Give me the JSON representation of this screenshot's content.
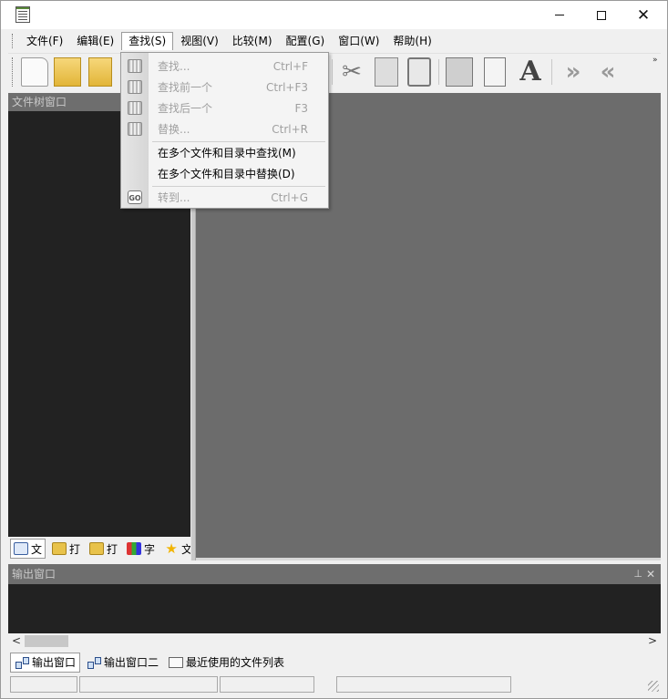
{
  "window": {
    "app_icon": "document-icon",
    "controls": {
      "minimize": "minimize-icon",
      "maximize": "maximize-icon",
      "close": "✕"
    }
  },
  "menubar": {
    "items": [
      "文件(F)",
      "编辑(E)",
      "查找(S)",
      "视图(V)",
      "比较(M)",
      "配置(G)",
      "窗口(W)",
      "帮助(H)"
    ],
    "active_index": 2
  },
  "toolbar": {
    "overflow": "»",
    "icons": [
      "new-document-icon",
      "open-folder-icon",
      "open-project-icon",
      "cut-icon",
      "copy-icon",
      "paste-icon",
      "select-icon",
      "list-icon",
      "font-icon",
      "next-difference-icon",
      "previous-difference-icon"
    ],
    "font_glyph": "A",
    "scissors_glyph": "✂",
    "next_glyph": "»",
    "prev_glyph": "«"
  },
  "search_menu": {
    "items": [
      {
        "label": "查找...",
        "shortcut": "Ctrl+F",
        "enabled": false,
        "icon": "binoculars-icon"
      },
      {
        "label": "查找前一个",
        "shortcut": "Ctrl+F3",
        "enabled": false,
        "icon": "find-previous-icon"
      },
      {
        "label": "查找后一个",
        "shortcut": "F3",
        "enabled": false,
        "icon": "find-next-icon"
      },
      {
        "label": "替换...",
        "shortcut": "Ctrl+R",
        "enabled": false,
        "icon": "replace-icon"
      },
      {
        "label": "在多个文件和目录中查找(M)",
        "shortcut": "",
        "enabled": true,
        "icon": ""
      },
      {
        "label": "在多个文件和目录中替换(D)",
        "shortcut": "",
        "enabled": true,
        "icon": ""
      },
      {
        "label": "转到...",
        "shortcut": "Ctrl+G",
        "enabled": false,
        "icon": "goto-icon"
      }
    ],
    "goto_icon_text": "GO"
  },
  "file_tree_pane": {
    "title": "文件树窗口",
    "tabs": [
      {
        "label": "文",
        "icon": "file-tree-icon"
      },
      {
        "label": "打",
        "icon": "open-file-icon"
      },
      {
        "label": "打",
        "icon": "print-icon"
      },
      {
        "label": "字",
        "icon": "charset-icon"
      },
      {
        "label": "文",
        "icon": "favorites-icon"
      }
    ],
    "star_glyph": "★"
  },
  "output_pane": {
    "title": "输出窗口",
    "pin_glyph": "⊥",
    "close_glyph": "✕",
    "scroll_left": "<",
    "scroll_right": ">",
    "tabs": [
      {
        "label": "输出窗口",
        "icon": "output-icon"
      },
      {
        "label": "输出窗口二",
        "icon": "output2-icon"
      },
      {
        "label": "最近使用的文件列表",
        "icon": "recent-files-icon"
      }
    ]
  },
  "statusbar": {
    "cells": [
      "",
      "",
      "",
      ""
    ]
  }
}
